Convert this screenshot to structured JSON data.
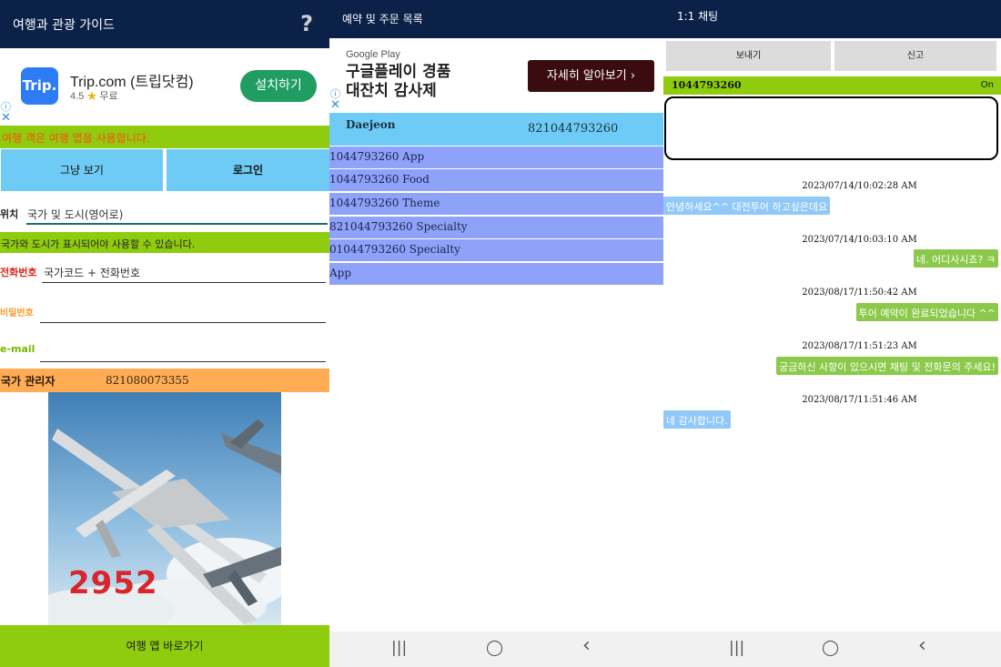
{
  "panel1": {
    "title": "여행과 관광 가이드",
    "help_glyph": "?",
    "ad": {
      "logo_text": "Trip.",
      "app_name": "Trip.com (트립닷컴)",
      "rating": "4.5",
      "star": "★",
      "price": "무료",
      "install_label": "설치하기",
      "info_glyph": "ⓘ",
      "close_glyph": "✕"
    },
    "notice_guest": "여행 객은 여행 앱을 사용합니다.",
    "buttons": {
      "guest_view": "그냥 보기",
      "login": "로그인"
    },
    "location": {
      "label": "위치",
      "value": "국가 및 도시(영어로)"
    },
    "notice_country": "국가와 도시가 표시되어야 사용할 수 있습니다.",
    "phone": {
      "label": "전화번호",
      "value": "국가코드 + 전화번호"
    },
    "password": {
      "label": "비밀번호",
      "value": ""
    },
    "email": {
      "label": "e-mail",
      "value": ""
    },
    "admin": {
      "label": "국가 관리자",
      "number": "821080073355"
    },
    "poster_number": "2952",
    "bottom_button": "여행 앱 바로가기",
    "colors": {
      "header": "#0b2148",
      "green": "#8fcc0e",
      "blue": "#6ecbf6",
      "orange": "#ffac55",
      "install": "#1f9d62"
    }
  },
  "panel2": {
    "title": "예약 및 주문 목록",
    "ad": {
      "source": "Google Play",
      "headline_line1": "구글플레이 경품",
      "headline_line2": "대잔치 감사제",
      "cta": "자세히 알아보기  ›",
      "info_glyph": "ⓘ",
      "close_glyph": "✕"
    },
    "location_row": {
      "city": "Daejeon",
      "number": "821044793260"
    },
    "orders": [
      "1044793260  App",
      "1044793260  Food",
      "1044793260  Theme",
      "821044793260  Specialty",
      "01044793260  Specialty",
      " App"
    ],
    "nav": {
      "recent": "|||",
      "home": "◯",
      "back": "‹"
    },
    "colors": {
      "row": "#8da2f8",
      "loc": "#6ecbf6",
      "cta": "#3b0c0f"
    }
  },
  "panel3": {
    "title": "1:1 채팅",
    "buttons": {
      "send": "보내기",
      "report": "신고"
    },
    "user": {
      "number": "1044793260",
      "status": "On"
    },
    "message_input": "",
    "messages": [
      {
        "time": "2023/07/14/10:02:28 AM",
        "text": "안녕하세요^^ 대전투어 하고싶은데요",
        "side": "in"
      },
      {
        "time": "2023/07/14/10:03:10 AM",
        "text": "네. 어디사시죠? ㅋ",
        "side": "out"
      },
      {
        "time": "2023/08/17/11:50:42 AM",
        "text": "투어 예약이 완료되었습니다 ^^",
        "side": "out"
      },
      {
        "time": "2023/08/17/11:51:23 AM",
        "text": "궁금하신 사항이 있으시면 채팅 및 전화문의 주세요!",
        "side": "out"
      },
      {
        "time": "2023/08/17/11:51:46 AM",
        "text": "네 감사합니다.",
        "side": "in"
      }
    ],
    "nav": {
      "recent": "|||",
      "home": "◯",
      "back": "‹"
    },
    "colors": {
      "incoming": "#90c8f8",
      "outgoing": "#8bc94a",
      "status_bar": "#8fcc0e"
    }
  }
}
